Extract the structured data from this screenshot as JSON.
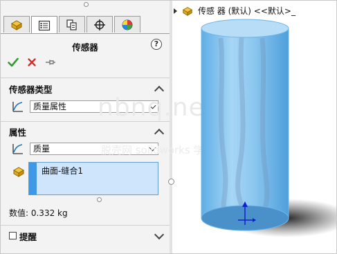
{
  "tabs": [
    {
      "icon": "feature-manager-icon",
      "active": false
    },
    {
      "icon": "property-manager-icon",
      "active": true
    },
    {
      "icon": "configuration-manager-icon",
      "active": false
    },
    {
      "icon": "dimxpert-icon",
      "active": false
    },
    {
      "icon": "display-manager-icon",
      "active": false
    }
  ],
  "panel": {
    "title": "传感器",
    "help_symbol": "?",
    "actions": {
      "ok_icon": "check-icon",
      "cancel_icon": "x-icon",
      "pin_icon": "pushpin-icon"
    }
  },
  "sensor_type": {
    "heading": "传感器类型",
    "selected": "质量属性"
  },
  "properties": {
    "heading": "属性",
    "selected": "质量",
    "entities": [
      "曲面-缝合1"
    ]
  },
  "value_text": "数值: 0.332 kg",
  "alert": {
    "label": "提醒",
    "checked": false
  },
  "tree": {
    "label": "传感 器 (默认) <<默认>_"
  },
  "watermark": {
    "main": "nbnq.net",
    "sub": "脱壳网 solidworks 学习"
  },
  "colors": {
    "cylinder": "#79bde8",
    "accent": "#3e98e6",
    "ok": "#2e9e2e",
    "cancel": "#d42a2a"
  }
}
